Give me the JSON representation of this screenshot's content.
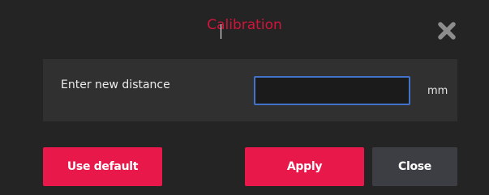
{
  "dialog": {
    "title": "Calibration",
    "field_label": "Enter new distance",
    "distance_value": "",
    "unit": "mm"
  },
  "buttons": {
    "use_default": "Use default",
    "apply": "Apply",
    "close": "Close"
  },
  "icons": {
    "close": "close-icon"
  },
  "colors": {
    "accent": "#e8194a",
    "title": "#d2143a",
    "background": "#242424",
    "panel": "#303030",
    "input_border": "#4272c9",
    "secondary_button": "#3c3e44"
  }
}
